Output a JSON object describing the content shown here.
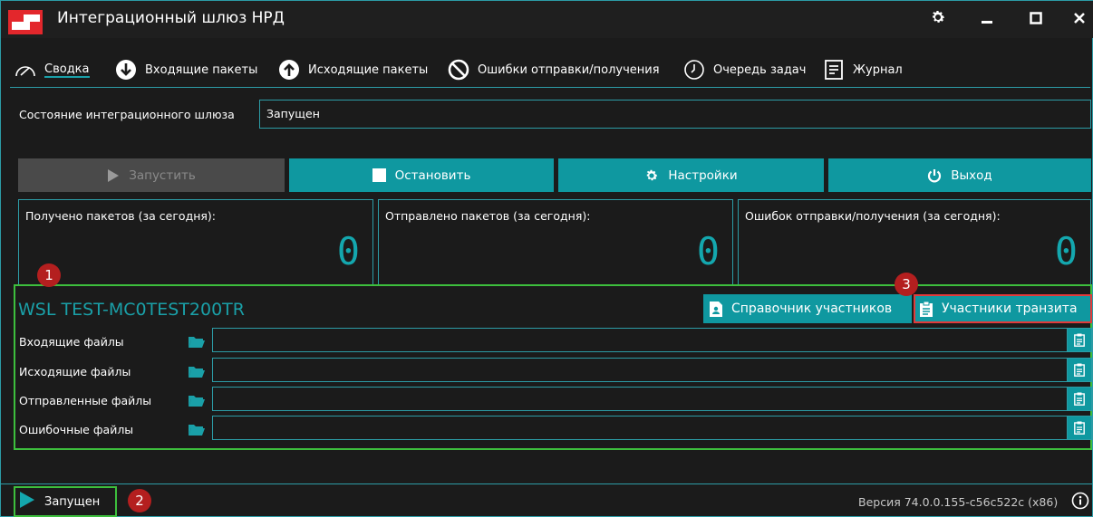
{
  "window": {
    "title": "Интеграционный шлюз НРД"
  },
  "tabs": [
    {
      "label": "Сводка",
      "icon": "gauge-icon",
      "active": true
    },
    {
      "label": "Входящие пакеты",
      "icon": "arrow-down-circle-icon"
    },
    {
      "label": "Исходящие пакеты",
      "icon": "arrow-up-circle-icon"
    },
    {
      "label": "Ошибки отправки/получения",
      "icon": "ban-icon"
    },
    {
      "label": "Очередь задач",
      "icon": "clock-icon"
    },
    {
      "label": "Журнал",
      "icon": "log-icon"
    }
  ],
  "gateway_state": {
    "label": "Состояние интеграционного шлюза",
    "value": "Запущен"
  },
  "actions": {
    "start": "Запустить",
    "stop": "Остановить",
    "settings": "Настройки",
    "exit": "Выход"
  },
  "counters": [
    {
      "label": "Получено пакетов (за сегодня):",
      "value": "0"
    },
    {
      "label": "Отправлено пакетов (за сегодня):",
      "value": "0"
    },
    {
      "label": "Ошибок отправки/получения (за сегодня):",
      "value": "0"
    }
  ],
  "node": {
    "title": "WSL TEST-MC0TEST200TR",
    "directory_button": "Справочник участников",
    "transit_button": "Участники транзита",
    "folders": [
      {
        "label": "Входящие файлы",
        "value": ""
      },
      {
        "label": "Исходящие файлы",
        "value": ""
      },
      {
        "label": "Отправленные файлы",
        "value": ""
      },
      {
        "label": "Ошибочные файлы",
        "value": ""
      }
    ]
  },
  "markers": [
    "1",
    "2",
    "3"
  ],
  "status_bar": {
    "status": "Запущен",
    "version": "Версия 74.0.0.155-c56c522c (x86)"
  },
  "colors": {
    "accent": "#0f98a0",
    "background": "#1b1b1b",
    "highlight_green": "#3dbf3d",
    "highlight_red": "#e13b3b",
    "logo_red": "#e3272c"
  }
}
